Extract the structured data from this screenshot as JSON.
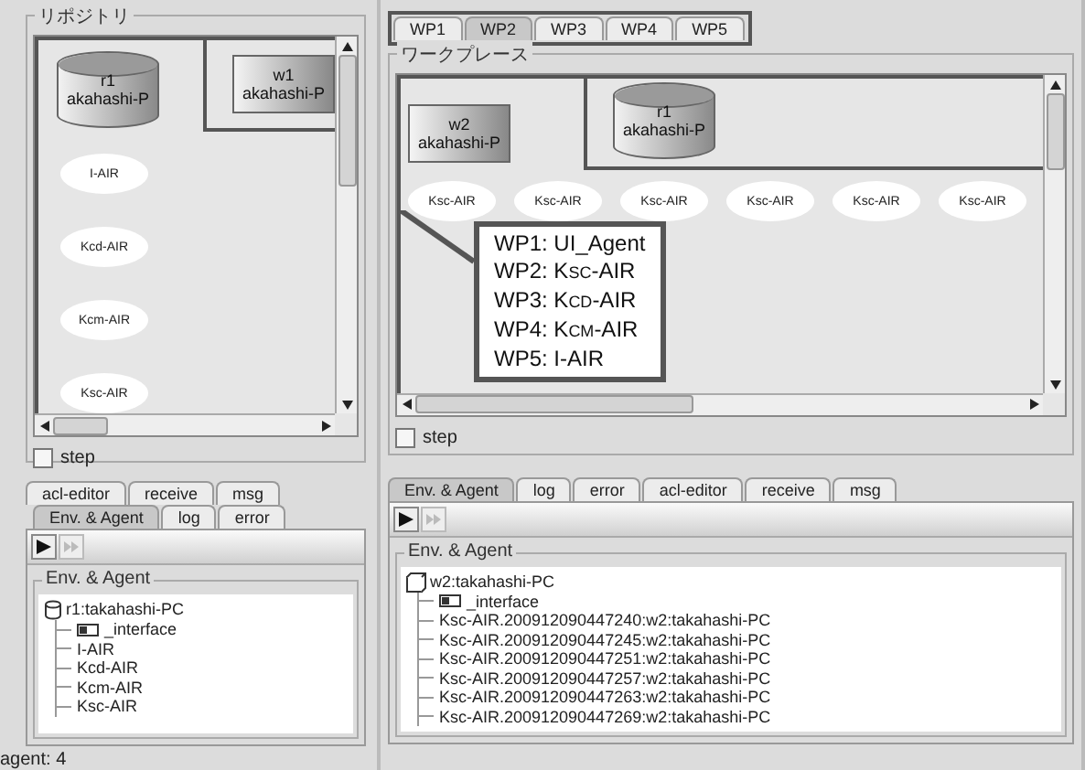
{
  "repository": {
    "title": "リポジトリ",
    "nodes": [
      {
        "kind": "repository",
        "name": "r1",
        "host": "akahashi-P"
      }
    ],
    "region_nodes": [
      {
        "kind": "workplace",
        "name": "w1",
        "host": "akahashi-P"
      }
    ],
    "agents": [
      "I-AIR",
      "Kcd-AIR",
      "Kcm-AIR",
      "Ksc-AIR"
    ],
    "step": {
      "label": "step",
      "checked": false
    }
  },
  "left_console": {
    "tab_rows": [
      [
        {
          "label": "acl-editor",
          "selected": false
        },
        {
          "label": "receive",
          "selected": false
        },
        {
          "label": "msg",
          "selected": false
        }
      ],
      [
        {
          "label": "Env. & Agent",
          "selected": true
        },
        {
          "label": "log",
          "selected": false
        },
        {
          "label": "error",
          "selected": false
        }
      ]
    ],
    "toolbar": [
      {
        "kind": "play",
        "disabled": false
      },
      {
        "kind": "fast_forward",
        "disabled": true
      }
    ],
    "tree_title": "Env. & Agent",
    "tree": {
      "kind": "repository",
      "label": "r1:takahashi-PC",
      "children": [
        {
          "kind": "interface",
          "label": "_interface"
        },
        {
          "kind": "agent",
          "label": "I-AIR"
        },
        {
          "kind": "agent",
          "label": "Kcd-AIR"
        },
        {
          "kind": "agent",
          "label": "Kcm-AIR"
        },
        {
          "kind": "agent",
          "label": "Ksc-AIR"
        }
      ]
    }
  },
  "status_bar": "agent: 4",
  "workplace_tabs": [
    {
      "label": "WP1",
      "selected": false
    },
    {
      "label": "WP2",
      "selected": true
    },
    {
      "label": "WP3",
      "selected": false
    },
    {
      "label": "WP4",
      "selected": false
    },
    {
      "label": "WP5",
      "selected": false
    }
  ],
  "workplace": {
    "title": "ワークプレース",
    "nodes": [
      {
        "kind": "workplace",
        "name": "w2",
        "host": "akahashi-P"
      }
    ],
    "region_nodes": [
      {
        "kind": "repository",
        "name": "r1",
        "host": "akahashi-P"
      }
    ],
    "agents": [
      "Ksc-AIR",
      "Ksc-AIR",
      "Ksc-AIR",
      "Ksc-AIR",
      "Ksc-AIR",
      "Ksc-AIR"
    ],
    "callout": [
      "WP1: UI_Agent",
      "WP2: K$_{SC}$-AIR",
      "WP3: K$_{CD}$-AIR",
      "WP4: K$_{CM}$-AIR",
      "WP5: I-AIR"
    ],
    "step": {
      "label": "step",
      "checked": false
    }
  },
  "right_console": {
    "tab_rows": [
      [
        {
          "label": "Env. & Agent",
          "selected": true
        },
        {
          "label": "log",
          "selected": false
        },
        {
          "label": "error",
          "selected": false
        },
        {
          "label": "acl-editor",
          "selected": false
        },
        {
          "label": "receive",
          "selected": false
        },
        {
          "label": "msg",
          "selected": false
        }
      ]
    ],
    "toolbar": [
      {
        "kind": "play",
        "disabled": false
      },
      {
        "kind": "fast_forward",
        "disabled": true
      }
    ],
    "tree_title": "Env. & Agent",
    "tree": {
      "kind": "workplace",
      "label": "w2:takahashi-PC",
      "children": [
        {
          "kind": "interface",
          "label": "_interface"
        },
        {
          "kind": "agent",
          "label": "Ksc-AIR.200912090447240:w2:takahashi-PC"
        },
        {
          "kind": "agent",
          "label": "Ksc-AIR.200912090447245:w2:takahashi-PC"
        },
        {
          "kind": "agent",
          "label": "Ksc-AIR.200912090447251:w2:takahashi-PC"
        },
        {
          "kind": "agent",
          "label": "Ksc-AIR.200912090447257:w2:takahashi-PC"
        },
        {
          "kind": "agent",
          "label": "Ksc-AIR.200912090447263:w2:takahashi-PC"
        },
        {
          "kind": "agent",
          "label": "Ksc-AIR.200912090447269:w2:takahashi-PC"
        }
      ]
    }
  }
}
